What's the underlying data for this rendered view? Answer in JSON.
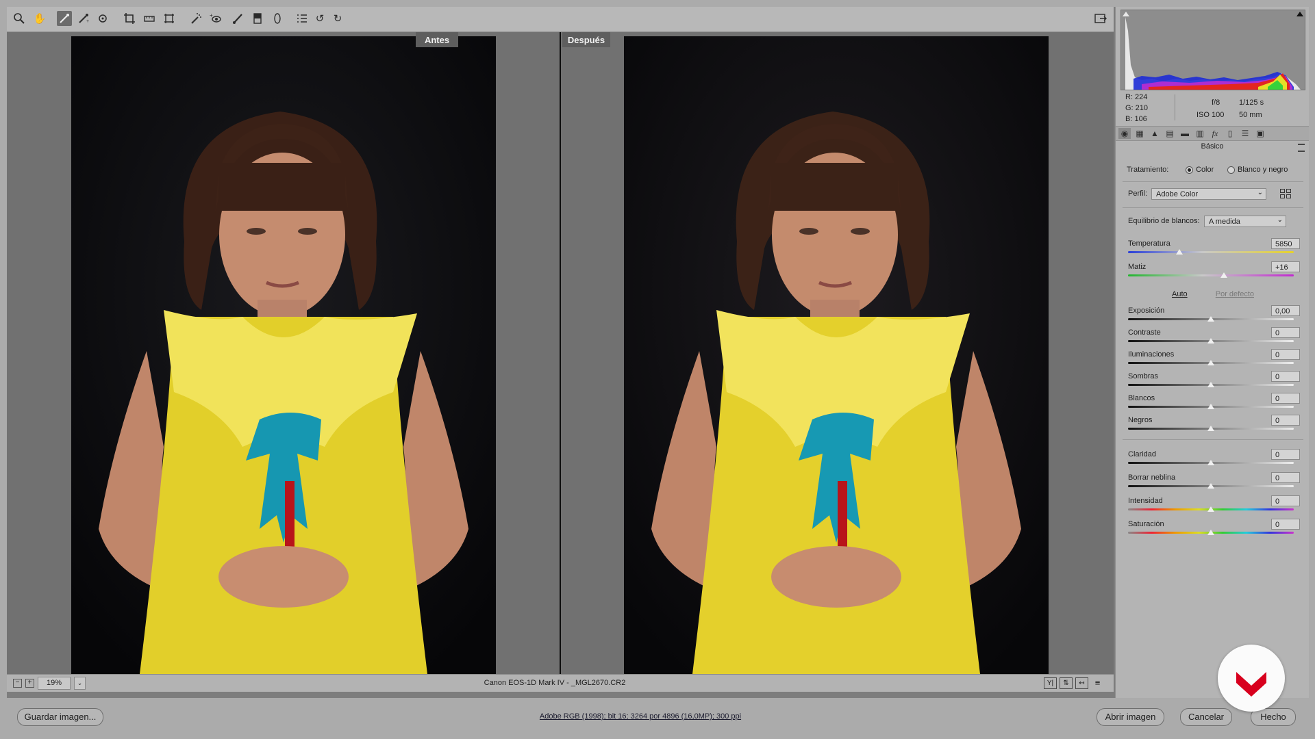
{
  "toolbar": {
    "tools": [
      "zoom-icon",
      "hand-icon",
      "white-balance-icon",
      "color-sampler-icon",
      "target-adjust-icon",
      "crop-icon",
      "straighten-icon",
      "transform-icon",
      "spot-removal-icon",
      "red-eye-icon",
      "adjustment-brush-icon",
      "graduated-filter-icon",
      "radial-filter-icon",
      "presets-icon",
      "rotate-left-icon",
      "rotate-right-icon"
    ],
    "active_tool": "white-balance-icon"
  },
  "preview": {
    "before_label": "Antes",
    "after_label": "Después"
  },
  "status": {
    "zoom": "19%",
    "file_label": "Canon EOS-1D Mark IV -  _MGL2670.CR2"
  },
  "info": {
    "r": "R:  224",
    "g": "G:  210",
    "b": "B:  106",
    "aperture": "f/8",
    "shutter": "1/125 s",
    "iso": "ISO 100",
    "focal": "50 mm"
  },
  "panel": {
    "title": "Básico",
    "treatment_label": "Tratamiento:",
    "treatment_color": "Color",
    "treatment_bw": "Blanco y negro",
    "profile_label": "Perfil:",
    "profile_value": "Adobe Color",
    "wb_label": "Equilibrio de blancos:",
    "wb_value": "A medida",
    "auto": "Auto",
    "default": "Por defecto",
    "sliders": [
      {
        "label": "Temperatura",
        "value": "5850",
        "pos": 0.31
      },
      {
        "label": "Matiz",
        "value": "+16",
        "pos": 0.58
      },
      {
        "label": "Exposición",
        "value": "0,00",
        "pos": 0.5
      },
      {
        "label": "Contraste",
        "value": "0",
        "pos": 0.5
      },
      {
        "label": "Iluminaciones",
        "value": "0",
        "pos": 0.5
      },
      {
        "label": "Sombras",
        "value": "0",
        "pos": 0.5
      },
      {
        "label": "Blancos",
        "value": "0",
        "pos": 0.5
      },
      {
        "label": "Negros",
        "value": "0",
        "pos": 0.5
      },
      {
        "label": "Claridad",
        "value": "0",
        "pos": 0.5
      },
      {
        "label": "Borrar neblina",
        "value": "0",
        "pos": 0.5
      },
      {
        "label": "Intensidad",
        "value": "0",
        "pos": 0.5
      },
      {
        "label": "Saturación",
        "value": "0",
        "pos": 0.5
      }
    ]
  },
  "bottom": {
    "save": "Guardar imagen...",
    "workflow": "Adobe RGB (1998); bit 16; 3264 por 4896 (16,0MP); 300 ppi",
    "open": "Abrir imagen",
    "cancel": "Cancelar",
    "done": "Hecho"
  },
  "colors": {
    "accent": "#d8001e",
    "background": "#ababab"
  }
}
